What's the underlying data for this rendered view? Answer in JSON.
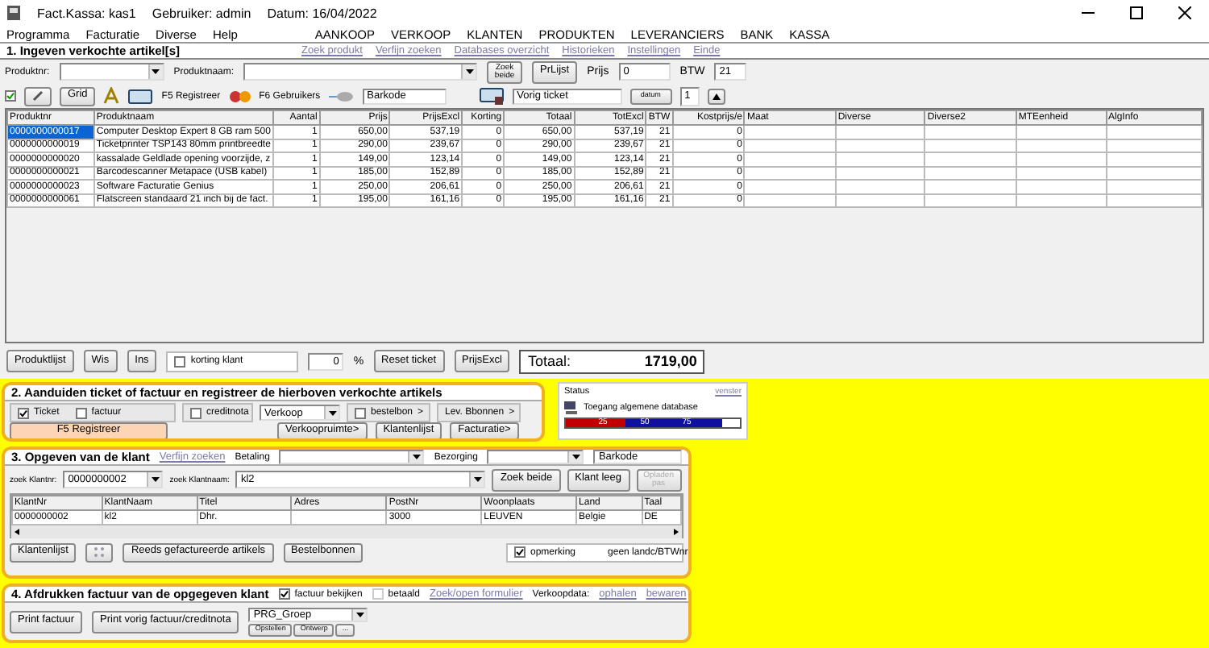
{
  "window": {
    "app": "Fact.Kassa: kas1",
    "user": "Gebruiker: admin",
    "date": "Datum: 16/04/2022"
  },
  "menu": {
    "left": [
      "Programma",
      "Facturatie",
      "Diverse",
      "Help"
    ],
    "right": [
      "AANKOOP",
      "VERKOOP",
      "KLANTEN",
      "PRODUKTEN",
      "LEVERANCIERS",
      "BANK",
      "KASSA"
    ]
  },
  "section1": {
    "title": "1. Ingeven verkochte artikel[s]",
    "links": [
      "Zoek produkt",
      "Verfijn zoeken",
      "Databases overzicht",
      "Historieken",
      "Instellingen",
      "Einde"
    ],
    "produktnr_label": "Produktnr:",
    "produktnaam_label": "Produktnaam:",
    "zoek_button": "Zoek beide",
    "prijslijst_button": "PrLijst",
    "prijs_label": "Prijs",
    "prijs_value": "0",
    "btw_label": "BTW",
    "btw_value": "21",
    "toolbar": {
      "check_on": true,
      "grid_button": "Grid",
      "register_button": "F5 Registreer",
      "users_button": "F6 Gebruikers",
      "barcode_value": "Barkode",
      "previous_ticket_value": "Vorig ticket",
      "date_button": "datum",
      "spin_value": "1"
    }
  },
  "table": {
    "columns": [
      "Produktnr",
      "Produktnaam",
      "Aantal",
      "Prijs",
      "PrijsExcl",
      "Korting",
      "Totaal",
      "TotExcl",
      "BTW",
      "Kostprijs/e",
      "Maat",
      "Diverse",
      "Diverse2",
      "MTEenheid",
      "AlgInfo"
    ],
    "rows": [
      {
        "selected": true,
        "cells": [
          "0000000000017",
          "Computer Desktop Expert 8 GB ram 500",
          "1",
          "650,00",
          "537,19",
          "0",
          "650,00",
          "537,19",
          "21",
          "0"
        ]
      },
      {
        "selected": false,
        "cells": [
          "0000000000019",
          "Ticketprinter TSP143 80mm printbreedte",
          "1",
          "290,00",
          "239,67",
          "0",
          "290,00",
          "239,67",
          "21",
          "0"
        ]
      },
      {
        "selected": false,
        "cells": [
          "0000000000020",
          "kassalade Geldlade opening voorzijde, z",
          "1",
          "149,00",
          "123,14",
          "0",
          "149,00",
          "123,14",
          "21",
          "0"
        ]
      },
      {
        "selected": false,
        "cells": [
          "0000000000021",
          "Barcodescanner Metapace (USB kabel)",
          "1",
          "185,00",
          "152,89",
          "0",
          "185,00",
          "152,89",
          "21",
          "0"
        ]
      },
      {
        "selected": false,
        "cells": [
          "0000000000023",
          "Software Facturatie Genius",
          "1",
          "250,00",
          "206,61",
          "0",
          "250,00",
          "206,61",
          "21",
          "0"
        ]
      },
      {
        "selected": false,
        "cells": [
          "0000000000061",
          "Flatscreen standaard 21 inch bij de fact.",
          "1",
          "195,00",
          "161,16",
          "0",
          "195,00",
          "161,16",
          "21",
          "0"
        ]
      }
    ]
  },
  "bottom_bar": {
    "produktlijst": "Produktlijst",
    "wis": "Wis",
    "ins": "Ins",
    "korting_label": "korting klant",
    "korting_checked": false,
    "korting_value": "0",
    "percent": "%",
    "reset": "Reset ticket",
    "prijs_excl": "PrijsExcl",
    "total_label": "Totaal:",
    "total_value": "1719,00"
  },
  "section2": {
    "title": "2. Aanduiden ticket of factuur en registreer de hierboven verkochte artikels",
    "checks": [
      {
        "label": "Ticket",
        "checked": true
      },
      {
        "label": "factuur",
        "checked": false
      },
      {
        "label": "creditnota",
        "checked": false
      }
    ],
    "verkoop_select": "Verkoop",
    "bestelbon": {
      "label": "bestelbon",
      "checked": false,
      "arrow": ">"
    },
    "lev_bonnen": {
      "label": "Lev. Bbonnen",
      "arrow": ">"
    },
    "register_button": "F5 Registreer",
    "buttons": [
      "Verkoopruimte>",
      "Klantenlijst",
      "Facturatie>"
    ]
  },
  "status": {
    "title": "Status",
    "link": "venster",
    "text": "Toegang algemene database",
    "meter": {
      "level": 0.9,
      "ticks": [
        "25",
        "50",
        "75"
      ]
    }
  },
  "section3": {
    "title": "3. Opgeven van de klant",
    "link": "Verfijn zoeken",
    "betaling_label": "Betaling",
    "bezorging_label": "Bezorging",
    "barcode_value": "Barkode",
    "klantnr_label": "zoek Klantnr:",
    "klantnr_value": "0000000002",
    "klantnaam_label": "zoek Klantnaam:",
    "klantnaam_value": "kl2",
    "zoek_button": "Zoek beide",
    "leeg_button": "Klant leeg",
    "opladen_button": {
      "label": "Opladen pas",
      "disabled": true
    },
    "table": {
      "columns": [
        "KlantNr",
        "KlantNaam",
        "Titel",
        "Adres",
        "PostNr",
        "Woonplaats",
        "Land",
        "Taal"
      ],
      "rows": [
        [
          "0000000002",
          "kl2",
          "Dhr.",
          "",
          "3000",
          "LEUVEN",
          "Belgie",
          "DE"
        ]
      ]
    },
    "buttons": [
      "Klantenlijst",
      "Reeds gefactureerde artikels",
      "Bestelbonnen"
    ],
    "opmerking": {
      "label": "opmerking",
      "checked": true
    },
    "note": "geen landc/BTWnr"
  },
  "section4": {
    "title": "4. Afdrukken factuur van de opgegeven klant",
    "bekijken": {
      "label": "factuur bekijken",
      "checked": true
    },
    "betaald": {
      "label": "betaald",
      "checked": false,
      "disabled": true
    },
    "link": "Zoek/open formulier",
    "verkoopdata_label": "Verkoopdata:",
    "verkoopdata_links": [
      "ophalen",
      "bewaren"
    ],
    "buttons": [
      "Print factuur",
      "Print vorig factuur/creditnota"
    ],
    "group_select": "PRG_Groep",
    "small_buttons": [
      "Opstellen",
      "Ontwerp",
      "..."
    ]
  }
}
